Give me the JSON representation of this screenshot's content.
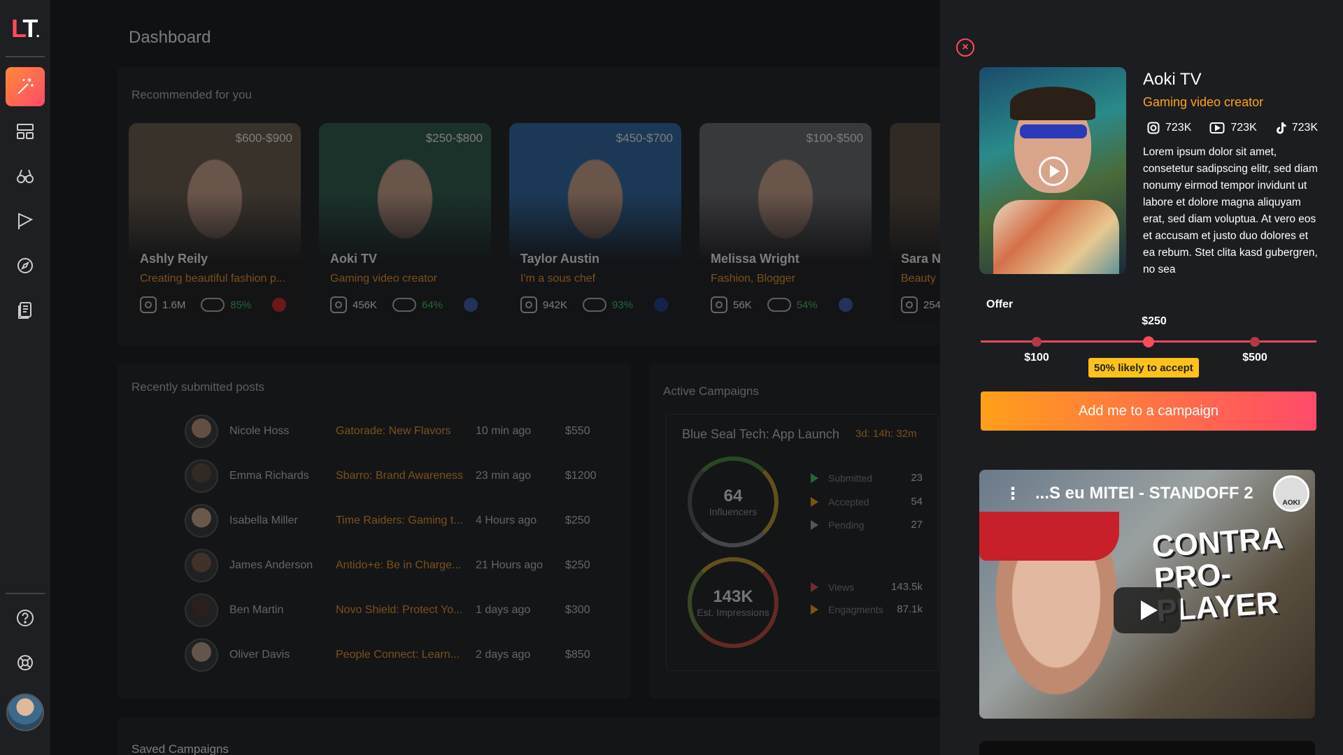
{
  "app": {
    "logo": "LT",
    "logo_dot": "."
  },
  "sidebar": {
    "items": [
      {
        "name": "magic-wand-icon",
        "active": true
      },
      {
        "name": "dashboard-icon"
      },
      {
        "name": "binoculars-icon"
      },
      {
        "name": "campaign-icon"
      },
      {
        "name": "compass-icon"
      },
      {
        "name": "document-icon"
      }
    ],
    "bottom": [
      {
        "name": "help-icon"
      },
      {
        "name": "support-icon"
      }
    ]
  },
  "dashboard": {
    "title": "Dashboard",
    "recommended_title": "Recommended for you",
    "cards": [
      {
        "name": "Ashly Reily",
        "price": "$600-$900",
        "desc": "Creating beautiful fashion p...",
        "followers": "1.6M",
        "pct": "85%",
        "flag": "#d22",
        "photo": "#6b5a4a"
      },
      {
        "name": "Aoki TV",
        "price": "$250-$800",
        "desc": "Gaming video creator",
        "followers": "456K",
        "pct": "64%",
        "flag": "#3a5ab0",
        "photo": "#2a5a4a"
      },
      {
        "name": "Taylor Austin",
        "price": "$450-$700",
        "desc": "I'm a sous chef",
        "followers": "942K",
        "pct": "93%",
        "flag": "#1a3a8a",
        "photo": "#2a6aa8"
      },
      {
        "name": "Melissa Wright",
        "price": "$100-$500",
        "desc": "Fashion, Blogger",
        "followers": "56K",
        "pct": "54%",
        "flag": "#3a5ab0",
        "photo": "#6a6a6a"
      },
      {
        "name": "Sara N",
        "price": "",
        "desc": "Beauty",
        "followers": "254",
        "pct": "",
        "flag": "",
        "photo": "#5a4a3a"
      }
    ],
    "recent_title": "Recently submitted posts",
    "posts": [
      {
        "name": "Nicole Hoss",
        "campaign": "Gatorade: New Flavors",
        "time": "10 min ago",
        "amount": "$550"
      },
      {
        "name": "Emma Richards",
        "campaign": "Sbarro: Brand Awareness",
        "time": "23 min ago",
        "amount": "$1200"
      },
      {
        "name": "Isabella Miller",
        "campaign": "Time Raiders: Gaming t...",
        "time": "4 Hours ago",
        "amount": "$250"
      },
      {
        "name": "James Anderson",
        "campaign": "Antido+e: Be in Charge...",
        "time": "21 Hours ago",
        "amount": "$250"
      },
      {
        "name": "Ben Martin",
        "campaign": "Novo Shield: Protect Yo...",
        "time": "1 days ago",
        "amount": "$300"
      },
      {
        "name": "Oliver Davis",
        "campaign": "People Connect: Learn...",
        "time": "2 days ago",
        "amount": "$850"
      }
    ],
    "active_title": "Active Campaigns",
    "campaign": {
      "title": "Blue Seal Tech: App Launch",
      "time_left": "3d: 14h: 32m",
      "influencers": "64",
      "influencers_label": "Influencers",
      "impressions": "143K",
      "impressions_label": "Est. Impressions",
      "rows": [
        {
          "label": "Submitted",
          "value": "23",
          "color": "#3ecf5a"
        },
        {
          "label": "Accepted",
          "value": "54",
          "color": "#ffa31a"
        },
        {
          "label": "Pending",
          "value": "27",
          "color": "#aaa"
        },
        {
          "label": "Views",
          "value": "143.5k",
          "color": "#e44a5a"
        },
        {
          "label": "Engagments",
          "value": "87.1k",
          "color": "#ffa31a"
        }
      ]
    },
    "saved_title": "Saved Campaigns"
  },
  "profile": {
    "close": "×",
    "name": "Aoki TV",
    "role": "Gaming video creator",
    "instagram": "723K",
    "youtube": "723K",
    "tiktok": "723K",
    "bio": "Lorem ipsum dolor sit amet, consetetur sadipscing elitr, sed diam nonumy eirmod tempor invidunt ut labore et dolore magna aliquyam erat, sed diam voluptua. At vero eos et accusam et justo duo dolores et ea rebum. Stet clita kasd gubergren, no sea",
    "offer_label": "Offer",
    "offer_value": "$250",
    "offer_min": "$100",
    "offer_max": "$500",
    "likely": "50% likely to accept",
    "cta": "Add me to a campaign",
    "video_title": "...S eu MITEI - STANDOFF 2",
    "video_overlay": "CONTRA PRO-PLAYER",
    "video_channel": "AOKI"
  }
}
